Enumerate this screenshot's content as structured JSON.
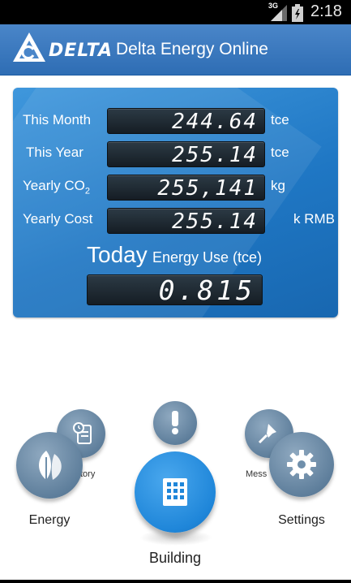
{
  "status_bar": {
    "network": "3G",
    "time": "2:18",
    "icons": [
      "signal-icon",
      "battery-icon"
    ]
  },
  "header": {
    "logo_text": "DELTA",
    "app_title": "Delta Energy Online"
  },
  "summary": {
    "rows": [
      {
        "label": "This Month",
        "value": "244.64",
        "unit": "tce"
      },
      {
        "label": "This Year",
        "value": "255.14",
        "unit": "tce"
      },
      {
        "label": "Yearly CO",
        "label_sub": "2",
        "value": "255,141",
        "unit": "kg"
      },
      {
        "label": "Yearly Cost",
        "value": "255.14",
        "unit": "k RMB"
      }
    ],
    "today": {
      "title": "Today",
      "subtitle": "Energy Use (tce)",
      "value": "0.815"
    }
  },
  "nav": {
    "energy": "Energy",
    "history_partial": "tory",
    "alert_icon": "exclamation-icon",
    "building": "Building",
    "message_partial": "Mess",
    "settings": "Settings"
  },
  "colors": {
    "header_blue": "#3a7bc2",
    "panel_blue": "#2a84cf",
    "accent_blue": "#1f86d9",
    "nav_gray": "#6f8fab"
  }
}
